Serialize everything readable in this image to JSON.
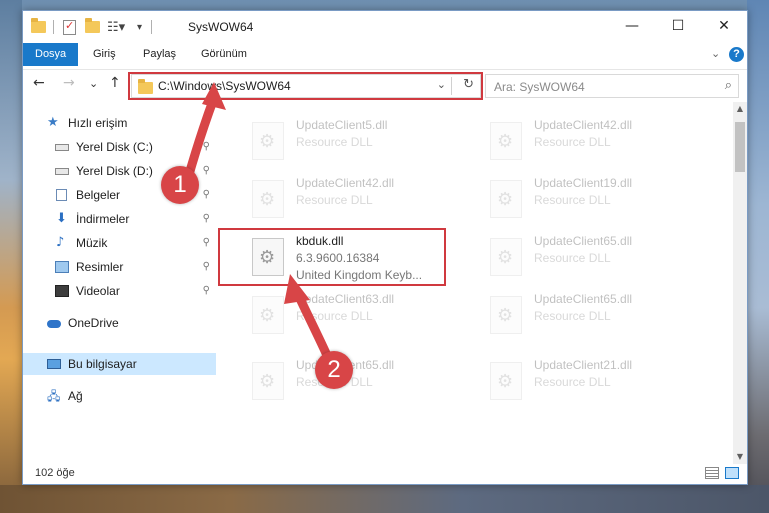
{
  "window": {
    "title": "SysWOW64",
    "minimize": "—",
    "maximize": "☐",
    "close": "✕"
  },
  "ribbon": {
    "tabs": [
      "Dosya",
      "Giriş",
      "Paylaş",
      "Görünüm"
    ],
    "expand": "⌄",
    "help": "?"
  },
  "nav": {
    "back": "←",
    "forward": "→",
    "recent": "⌄",
    "up": "↑"
  },
  "address": {
    "path": "C:\\Windows\\SysWOW64",
    "dropdown": "⌄",
    "refresh": "↻"
  },
  "search": {
    "placeholder": "Ara: SysWOW64",
    "icon": "⌕"
  },
  "sidebar": {
    "items": [
      {
        "label": "Hızlı erişim",
        "icon": "star-icon",
        "pinned": false
      },
      {
        "label": "Yerel Disk (C:)",
        "icon": "drive-icon",
        "pinned": true
      },
      {
        "label": "Yerel Disk (D:)",
        "icon": "drive-icon",
        "pinned": true
      },
      {
        "label": "Belgeler",
        "icon": "documents-icon",
        "pinned": true
      },
      {
        "label": "İndirmeler",
        "icon": "download-icon",
        "pinned": true
      },
      {
        "label": "Müzik",
        "icon": "music-icon",
        "pinned": true
      },
      {
        "label": "Resimler",
        "icon": "pictures-icon",
        "pinned": true
      },
      {
        "label": "Videolar",
        "icon": "videos-icon",
        "pinned": true
      },
      {
        "label": "OneDrive",
        "icon": "cloud-icon",
        "pinned": false
      },
      {
        "label": "Bu bilgisayar",
        "icon": "computer-icon",
        "pinned": false
      },
      {
        "label": "Ağ",
        "icon": "network-icon",
        "pinned": false
      }
    ],
    "pin_glyph": "📌"
  },
  "files": [
    {
      "name": "UpdateClient5.dll",
      "desc": "Resource DLL",
      "meta": ""
    },
    {
      "name": "UpdateClient42.dll",
      "desc": "Resource DLL",
      "meta": ""
    },
    {
      "name": "UpdateClient42.dll",
      "desc": "Resource DLL",
      "meta": ""
    },
    {
      "name": "UpdateClient19.dll",
      "desc": "Resource DLL",
      "meta": ""
    },
    {
      "name": "kbduk.dll",
      "desc": "6.3.9600.16384",
      "meta": "United Kingdom Keyb..."
    },
    {
      "name": "UpdateClient65.dll",
      "desc": "Resource DLL",
      "meta": ""
    },
    {
      "name": "UpdateClient63.dll",
      "desc": "Resource DLL",
      "meta": ""
    },
    {
      "name": "UpdateClient65.dll",
      "desc": "Resource DLL",
      "meta": ""
    },
    {
      "name": "UpdateClient65.dll",
      "desc": "Resource DLL",
      "meta": ""
    },
    {
      "name": "UpdateClient21.dll",
      "desc": "Resource DLL",
      "meta": ""
    }
  ],
  "status": {
    "count": "102 öğe"
  },
  "annotations": {
    "step1": "1",
    "step2": "2"
  },
  "colors": {
    "accent": "#1979ca",
    "highlight": "#d0393f",
    "step": "#d84547"
  }
}
